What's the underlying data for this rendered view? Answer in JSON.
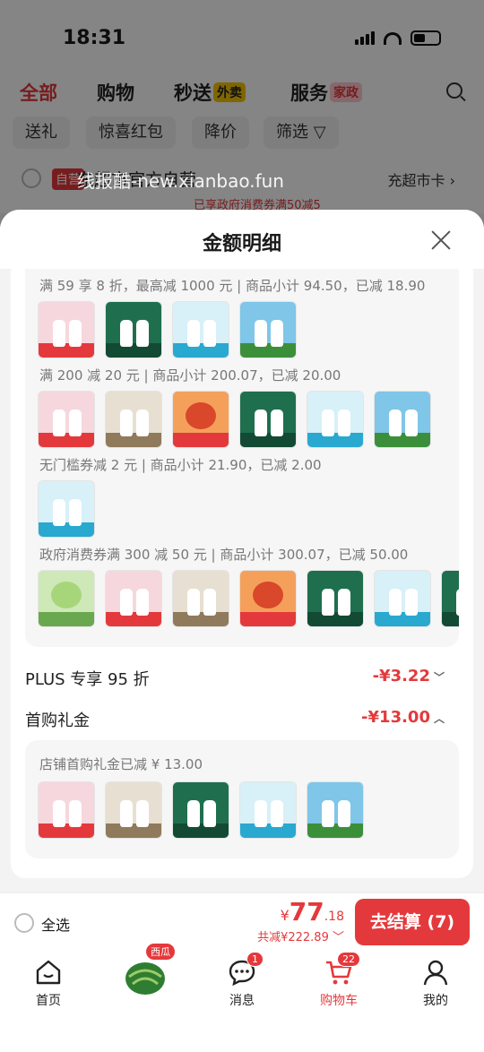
{
  "status": {
    "time": "18:31"
  },
  "tabs": [
    {
      "label": "全部",
      "active": true
    },
    {
      "label": "购物",
      "active": false
    },
    {
      "label": "秒送",
      "badge": "外卖",
      "badge_color": "#f5c400"
    },
    {
      "label": "服务",
      "badge": "家政",
      "badge_color": "#ff4d6a"
    }
  ],
  "filters": [
    "送礼",
    "惊喜红包",
    "降价",
    "筛选"
  ],
  "store": {
    "tag": "自营",
    "name": "东超市官方自营",
    "link": "充超市卡",
    "promo": "已享政府消费券满50减5"
  },
  "watermark": "线报酷-new.xianbao.fun",
  "sheet": {
    "title": "金额明细",
    "groups": [
      {
        "title": "满 59 享 8 折，最高减 1000 元 | 商品小计 94.50，已减 18.90",
        "thumbs": [
          "pink",
          "green",
          "blue",
          "sky"
        ]
      },
      {
        "title": "满 200 减 20 元 | 商品小计 200.07，已减 20.00",
        "thumbs": [
          "pink",
          "beige",
          "orange",
          "green",
          "blue",
          "sky"
        ]
      },
      {
        "title": "无门槛券减 2 元 | 商品小计 21.90，已减 2.00",
        "thumbs": [
          "blue"
        ]
      },
      {
        "title": "政府消费券满 300 减 50 元 | 商品小计 300.07，已减 50.00",
        "thumbs": [
          "melon",
          "pink",
          "beige",
          "orange",
          "green",
          "blue",
          "green"
        ]
      }
    ],
    "rows": [
      {
        "label": "PLUS 专享 95 折",
        "value": "-¥3.22",
        "chev": "﹀"
      },
      {
        "label": "首购礼金",
        "value": "-¥13.00",
        "chev": "︿"
      }
    ],
    "gift": {
      "title": "店铺首购礼金已减 ¥ 13.00",
      "thumbs": [
        "pink",
        "beige",
        "green",
        "blue",
        "sky"
      ]
    }
  },
  "checkout": {
    "select_all": "全选",
    "currency": "¥",
    "total_int": "77",
    "total_dec": ".18",
    "saved": "共减¥222.89",
    "saved_chev": "﹀",
    "button": "去结算 (7)"
  },
  "nav": [
    {
      "label": "首页",
      "icon": "home-icon"
    },
    {
      "label": "西瓜",
      "icon": "watermelon-icon"
    },
    {
      "label": "消息",
      "icon": "message-icon",
      "badge": "1"
    },
    {
      "label": "购物车",
      "icon": "cart-icon",
      "badge": "22",
      "active": true
    },
    {
      "label": "我的",
      "icon": "profile-icon"
    }
  ]
}
